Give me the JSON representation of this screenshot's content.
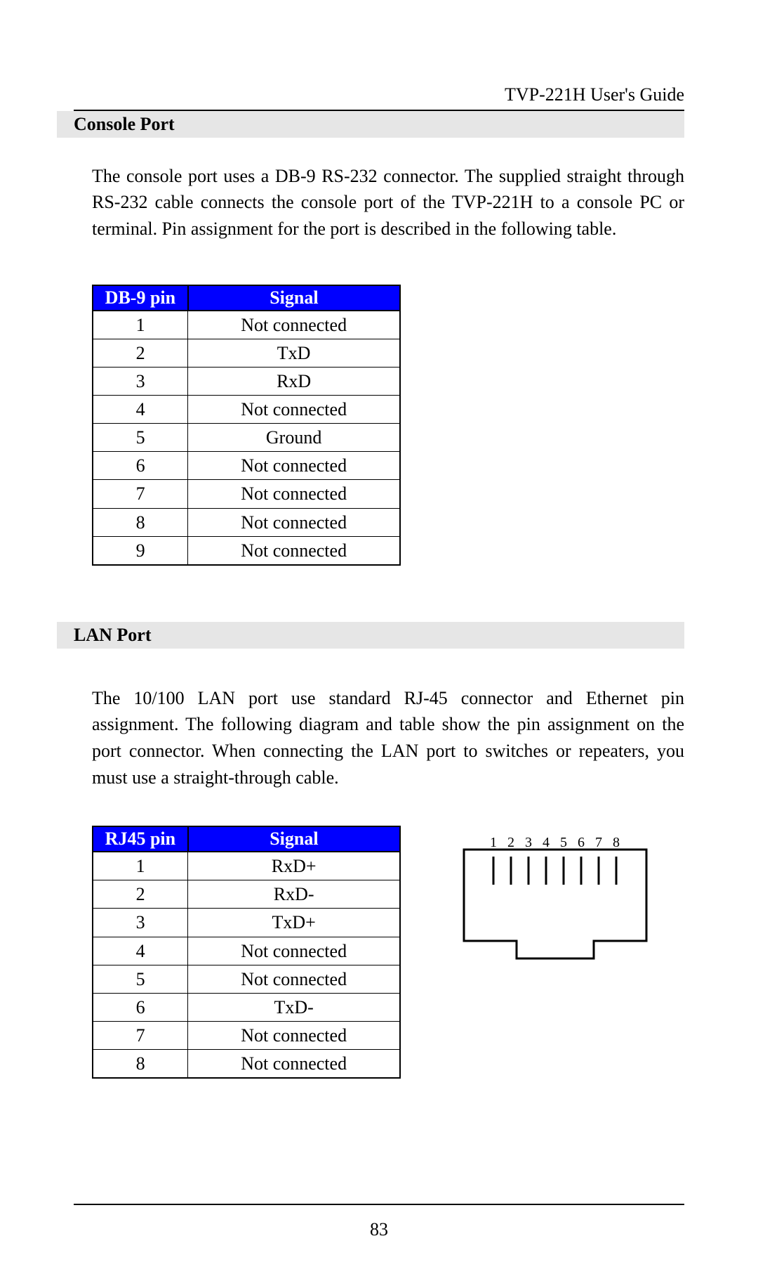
{
  "header": {
    "title": "TVP-221H User's Guide"
  },
  "sections": {
    "console": {
      "heading": "Console Port",
      "body": "The console port uses a DB-9 RS-232 connector. The supplied straight through RS-232 cable connects the console port of the TVP-221H to a console PC or terminal. Pin assignment for the port is described in the following table.",
      "table": {
        "headers": [
          "DB-9 pin",
          "Signal"
        ],
        "rows": [
          {
            "pin": "1",
            "signal": "Not connected"
          },
          {
            "pin": "2",
            "signal": "TxD"
          },
          {
            "pin": "3",
            "signal": "RxD"
          },
          {
            "pin": "4",
            "signal": "Not connected"
          },
          {
            "pin": "5",
            "signal": "Ground"
          },
          {
            "pin": "6",
            "signal": "Not connected"
          },
          {
            "pin": "7",
            "signal": "Not connected"
          },
          {
            "pin": "8",
            "signal": "Not connected"
          },
          {
            "pin": "9",
            "signal": "Not connected"
          }
        ]
      }
    },
    "lan": {
      "heading": "LAN Port",
      "body": "The 10/100 LAN port use standard RJ-45 connector and Ethernet pin assignment. The following diagram and table show the pin assignment on the port connector. When connecting the LAN port to switches or repeaters, you must use a straight-through cable.",
      "table": {
        "headers": [
          "RJ45 pin",
          "Signal"
        ],
        "rows": [
          {
            "pin": "1",
            "signal": "RxD+"
          },
          {
            "pin": "2",
            "signal": "RxD-"
          },
          {
            "pin": "3",
            "signal": "TxD+"
          },
          {
            "pin": "4",
            "signal": "Not connected"
          },
          {
            "pin": "5",
            "signal": "Not connected"
          },
          {
            "pin": "6",
            "signal": "TxD-"
          },
          {
            "pin": "7",
            "signal": "Not connected"
          },
          {
            "pin": "8",
            "signal": "Not connected"
          }
        ]
      },
      "diagram_labels": [
        "1",
        "2",
        "3",
        "4",
        "5",
        "6",
        "7",
        "8"
      ]
    }
  },
  "footer": {
    "page_number": "83"
  }
}
